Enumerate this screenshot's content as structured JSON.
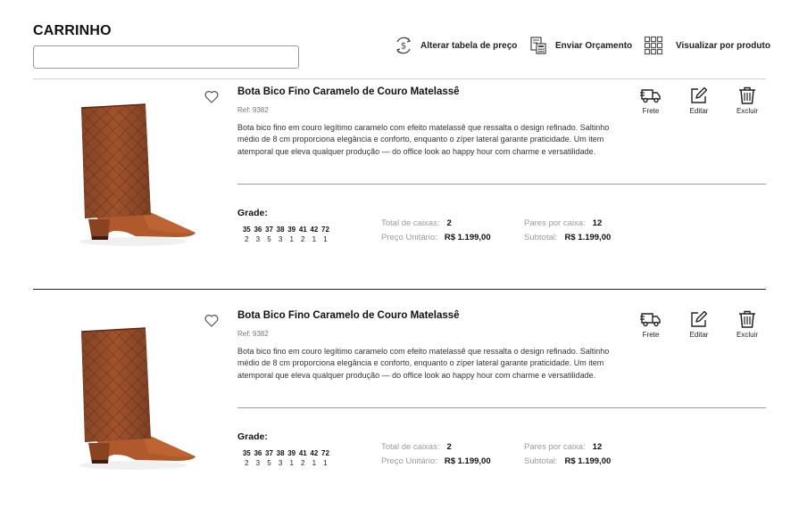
{
  "header": {
    "title": "CARRINHO",
    "search_value": "",
    "toolbar": {
      "change_price_table": "Alterar tabela de preço",
      "send_quote": "Enviar Orçamento",
      "view_by_product": "Visualizar por produto"
    }
  },
  "products": [
    {
      "name": "Bota Bico Fino Caramelo de Couro Matelassê",
      "ref": "Ref: 9382",
      "description": "Bota bico fino em couro legítimo caramelo com efeito matelassê que ressalta o design refinado. Saltinho médio de 8 cm proporciona elegância e conforto, enquanto o zíper lateral garante praticidade. Um item atemporal que eleva qualquer produção — do office look ao happy hour com charme e versatilidade.",
      "actions": {
        "freight": "Frete",
        "edit": "Editar",
        "delete": "Excluir"
      },
      "grade_title": "Grade:",
      "sizes": [
        "35",
        "36",
        "37",
        "38",
        "39",
        "41",
        "42",
        "72"
      ],
      "quantities": [
        "2",
        "3",
        "5",
        "3",
        "1",
        "2",
        "1",
        "1"
      ],
      "total_boxes_label": "Total de caixas:",
      "total_boxes": "2",
      "pairs_per_box_label": "Pares por caixa:",
      "pairs_per_box": "12",
      "unit_price_label": "Preço Unitário:",
      "unit_price": "R$ 1.199,00",
      "subtotal_label": "Subtotal:",
      "subtotal": "R$ 1.199,00"
    },
    {
      "name": "Bota Bico Fino Caramelo de Couro Matelassê",
      "ref": "Ref: 9382",
      "description": "Bota bico fino em couro legítimo caramelo com efeito matelassê que ressalta o design refinado. Saltinho médio de 8 cm proporciona elegância e conforto, enquanto o zíper lateral garante praticidade. Um item atemporal que eleva qualquer produção — do office look ao happy hour com charme e versatilidade.",
      "actions": {
        "freight": "Frete",
        "edit": "Editar",
        "delete": "Excluir"
      },
      "grade_title": "Grade:",
      "sizes": [
        "35",
        "36",
        "37",
        "38",
        "39",
        "41",
        "42",
        "72"
      ],
      "quantities": [
        "2",
        "3",
        "5",
        "3",
        "1",
        "2",
        "1",
        "1"
      ],
      "total_boxes_label": "Total de caixas:",
      "total_boxes": "2",
      "pairs_per_box_label": "Pares por caixa:",
      "pairs_per_box": "12",
      "unit_price_label": "Preço Unitário:",
      "unit_price": "R$ 1.199,00",
      "subtotal_label": "Subtotal:",
      "subtotal": "R$ 1.199,00"
    }
  ],
  "icons": {
    "price_table": "currency-refresh-icon",
    "quote": "calculator-document-icon",
    "view": "grid-icon",
    "favorite": "heart-icon",
    "freight": "truck-icon",
    "edit": "edit-icon",
    "delete": "trash-icon"
  },
  "colors": {
    "boot_leather": "#a0522d",
    "text": "#111111",
    "muted": "#9a9a9a"
  }
}
